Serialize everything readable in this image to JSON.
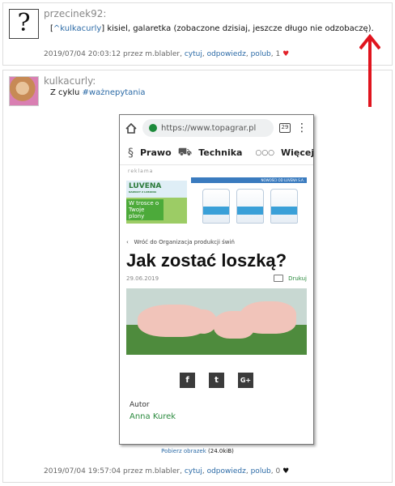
{
  "comments": [
    {
      "author": "przecinek92:",
      "avatar": "question-mark-avatar",
      "avatar_glyph": "?",
      "text_open": "[",
      "mention": "^kulkacurly",
      "text_close": "] kisiel, galaretka (zobaczone dzisiaj, jeszcze długo nie odzobaczę).",
      "meta": {
        "date": "2019/07/04 20:03:12 przez m.blabler,",
        "cite": "cytuj",
        "reply": "odpowiedz",
        "like": "polub",
        "count": "1",
        "heart": "♥"
      }
    },
    {
      "author": "kulkacurly:",
      "avatar": "user-photo-avatar",
      "text_prefix": "Z cyklu",
      "hashtag": "#ważnepytania",
      "screenshot": {
        "url": "https://www.topagrar.pl",
        "tabs_count": "29",
        "nav": [
          "Prawo",
          "Technika",
          "Więcej"
        ],
        "ad_label": "reklama",
        "ad": {
          "brand": "LUVENA",
          "brand_sub": "NAWOZY Z LUBONIA",
          "header": "NOWOŚCI OD LUVENA S.A.",
          "slogan": "W trosce o Twoje plony"
        },
        "breadcrumb": "Wróć do Organizacja produkcji świń",
        "title": "Jak zostać loszką?",
        "date": "29.06.2019",
        "print": "Drukuj",
        "social": [
          "f",
          "t",
          "G+"
        ],
        "author_label": "Autor",
        "author_name": "Anna Kurek"
      },
      "download": {
        "link": "Pobierz obrazek",
        "size": "(24.0kiB)"
      },
      "meta": {
        "date": "2019/07/04 19:57:04 przez m.blabler,",
        "cite": "cytuj",
        "reply": "odpowiedz",
        "like": "polub",
        "count": "0",
        "heart": "♥"
      }
    }
  ],
  "colors": {
    "link": "#2b6aa6",
    "heart_liked": "#e2222a",
    "arrow": "#e0141e"
  }
}
